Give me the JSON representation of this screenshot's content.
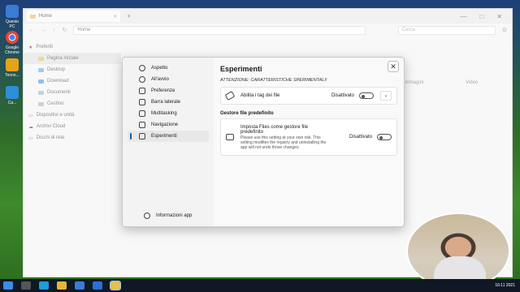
{
  "desktop": {
    "icons": [
      {
        "label": "Questo PC",
        "icon": "pc-icon"
      },
      {
        "label": "Google Chrome",
        "icon": "chrome-icon"
      },
      {
        "label": "Tecno...",
        "icon": "app-icon"
      },
      {
        "label": "Ca...",
        "icon": "app-icon"
      }
    ]
  },
  "explorer": {
    "tab_label": "Home",
    "address": "Home",
    "search_placeholder": "Cerca",
    "sidebar": [
      {
        "label": "Preferiti",
        "level": 0
      },
      {
        "label": "Pagina iniziale",
        "level": 1,
        "selected": true
      },
      {
        "label": "Desktop",
        "level": 1
      },
      {
        "label": "Download",
        "level": 1
      },
      {
        "label": "Documenti",
        "level": 1
      },
      {
        "label": "Cestino",
        "level": 1
      },
      {
        "label": "Dispositivi e unità",
        "level": 0
      },
      {
        "label": "Archivi Cloud",
        "level": 0
      },
      {
        "label": "Dischi di rete",
        "level": 0
      }
    ],
    "tiles": [
      "Immagini",
      "Video"
    ]
  },
  "dialog": {
    "nav": [
      {
        "label": "Aspetto",
        "icon": "palette-icon"
      },
      {
        "label": "All'avvio",
        "icon": "power-icon"
      },
      {
        "label": "Preferenze",
        "icon": "preferences-icon"
      },
      {
        "label": "Barra laterale",
        "icon": "sidebar-icon"
      },
      {
        "label": "Multitasking",
        "icon": "multitasking-icon"
      },
      {
        "label": "Navigazione",
        "icon": "navigation-icon"
      },
      {
        "label": "Esperimenti",
        "icon": "experiments-icon",
        "active": true
      }
    ],
    "about_label": "Informazioni app",
    "title": "Esperimenti",
    "warning": "ATTENZIONE: CARATTERISTICHE SPERIMENTALI!",
    "tags": {
      "label": "Abilita i tag dei file",
      "state": "Disattivato"
    },
    "section_title": "Gestore file predefinito",
    "default_manager": {
      "label": "Imposta Files come gestore file predefinito",
      "description": "Please use this setting at your own risk. This setting modifies the registry and uninstalling the app will not undo those changes.",
      "state": "Disattivato"
    }
  },
  "taskbar": {
    "time": "16:11 2021"
  }
}
